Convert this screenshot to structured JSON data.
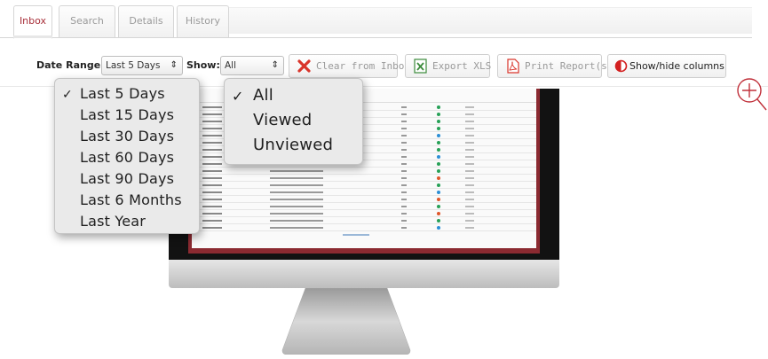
{
  "tabs": [
    {
      "label": "Inbox",
      "active": true
    },
    {
      "label": "Search",
      "active": false
    },
    {
      "label": "Details",
      "active": false
    },
    {
      "label": "History",
      "active": false
    }
  ],
  "toolbar": {
    "date_range_label": "Date Range:",
    "date_range_value": "Last 5 Days",
    "show_label": "Show:",
    "show_value": "All",
    "clear_label": "Clear from Inbox",
    "export_label": "Export XLS",
    "print_label": "Print Report(s)",
    "columns_label": "Show/hide columns"
  },
  "date_range_menu": {
    "selected": "Last 5 Days",
    "options": [
      "Last 5 Days",
      "Last 15 Days",
      "Last 30 Days",
      "Last 60 Days",
      "Last 90 Days",
      "Last 6 Months",
      "Last Year"
    ]
  },
  "show_menu": {
    "selected": "All",
    "options": [
      "All",
      "Viewed",
      "Unviewed"
    ]
  },
  "icons": {
    "clear": "x-icon",
    "export": "excel-icon",
    "print": "pdf-icon",
    "columns": "half-circle-icon",
    "zoom": "zoom-in-icon"
  },
  "colors": {
    "accent": "#a8303a",
    "clear_icon": "#d9352b",
    "excel_icon": "#3a8a3a",
    "pdf_icon": "#d9352b",
    "columns_icon": "#d32020"
  }
}
